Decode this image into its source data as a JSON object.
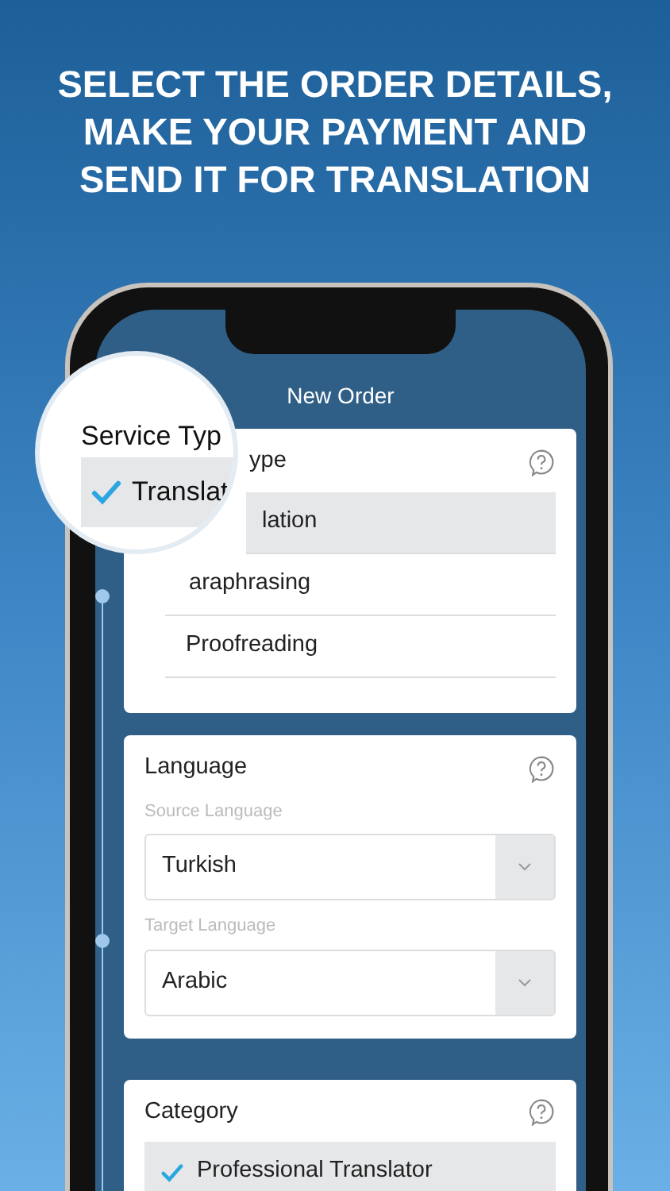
{
  "headline": [
    "SELECT THE ORDER DETAILS,",
    "MAKE YOUR PAYMENT AND",
    "SEND IT FOR TRANSLATION"
  ],
  "screen": {
    "title": "New Order"
  },
  "magnifier": {
    "title": "Service Typ",
    "option": {
      "label": "Translat",
      "selected": true
    }
  },
  "service_card": {
    "title": "ype",
    "options": [
      {
        "label": "lation",
        "selected": true
      },
      {
        "label": "araphrasing",
        "selected": false
      },
      {
        "label": "Proofreading",
        "selected": false
      }
    ]
  },
  "language_card": {
    "title": "Language",
    "fields": [
      {
        "label": "Source Language",
        "value": "Turkish"
      },
      {
        "label": "Target Language",
        "value": "Arabic"
      }
    ]
  },
  "category_card": {
    "title": "Category",
    "options": [
      {
        "label": "Professional Translator",
        "selected": true
      }
    ]
  }
}
